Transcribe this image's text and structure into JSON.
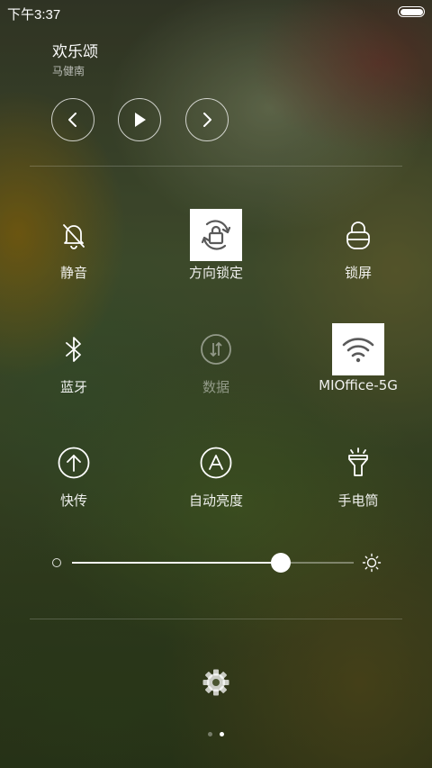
{
  "status_bar": {
    "time": "下午3:37",
    "battery_level": 1.0
  },
  "music": {
    "title": "欢乐颂",
    "artist": "马健南",
    "controls": [
      "chevron-left-icon",
      "play-icon",
      "chevron-right-icon"
    ]
  },
  "toggles": [
    {
      "label": "静音",
      "icon": "bell-off-icon",
      "active": false,
      "enabled": true
    },
    {
      "label": "方向锁定",
      "icon": "rotation-lock-icon",
      "active": true,
      "enabled": true
    },
    {
      "label": "锁屏",
      "icon": "lock-icon",
      "active": false,
      "enabled": true
    },
    {
      "label": "蓝牙",
      "icon": "bluetooth-icon",
      "active": false,
      "enabled": true
    },
    {
      "label": "数据",
      "icon": "mobile-data-icon",
      "active": false,
      "enabled": false
    },
    {
      "label": "MIOffice-5G",
      "icon": "wifi-icon",
      "active": true,
      "enabled": true
    },
    {
      "label": "快传",
      "icon": "upload-icon",
      "active": false,
      "enabled": true
    },
    {
      "label": "自动亮度",
      "icon": "auto-brightness-icon",
      "active": false,
      "enabled": true
    },
    {
      "label": "手电筒",
      "icon": "flashlight-icon",
      "active": false,
      "enabled": true
    }
  ],
  "brightness": {
    "level": 0.74,
    "low_icon": "brightness-low-icon",
    "high_icon": "sun-icon"
  },
  "settings_icon": "gear-icon",
  "pager": {
    "pages": 2,
    "current": 2
  },
  "colors": {
    "active_tile_bg": "#ffffff",
    "active_icon": "#5a5a5a"
  }
}
